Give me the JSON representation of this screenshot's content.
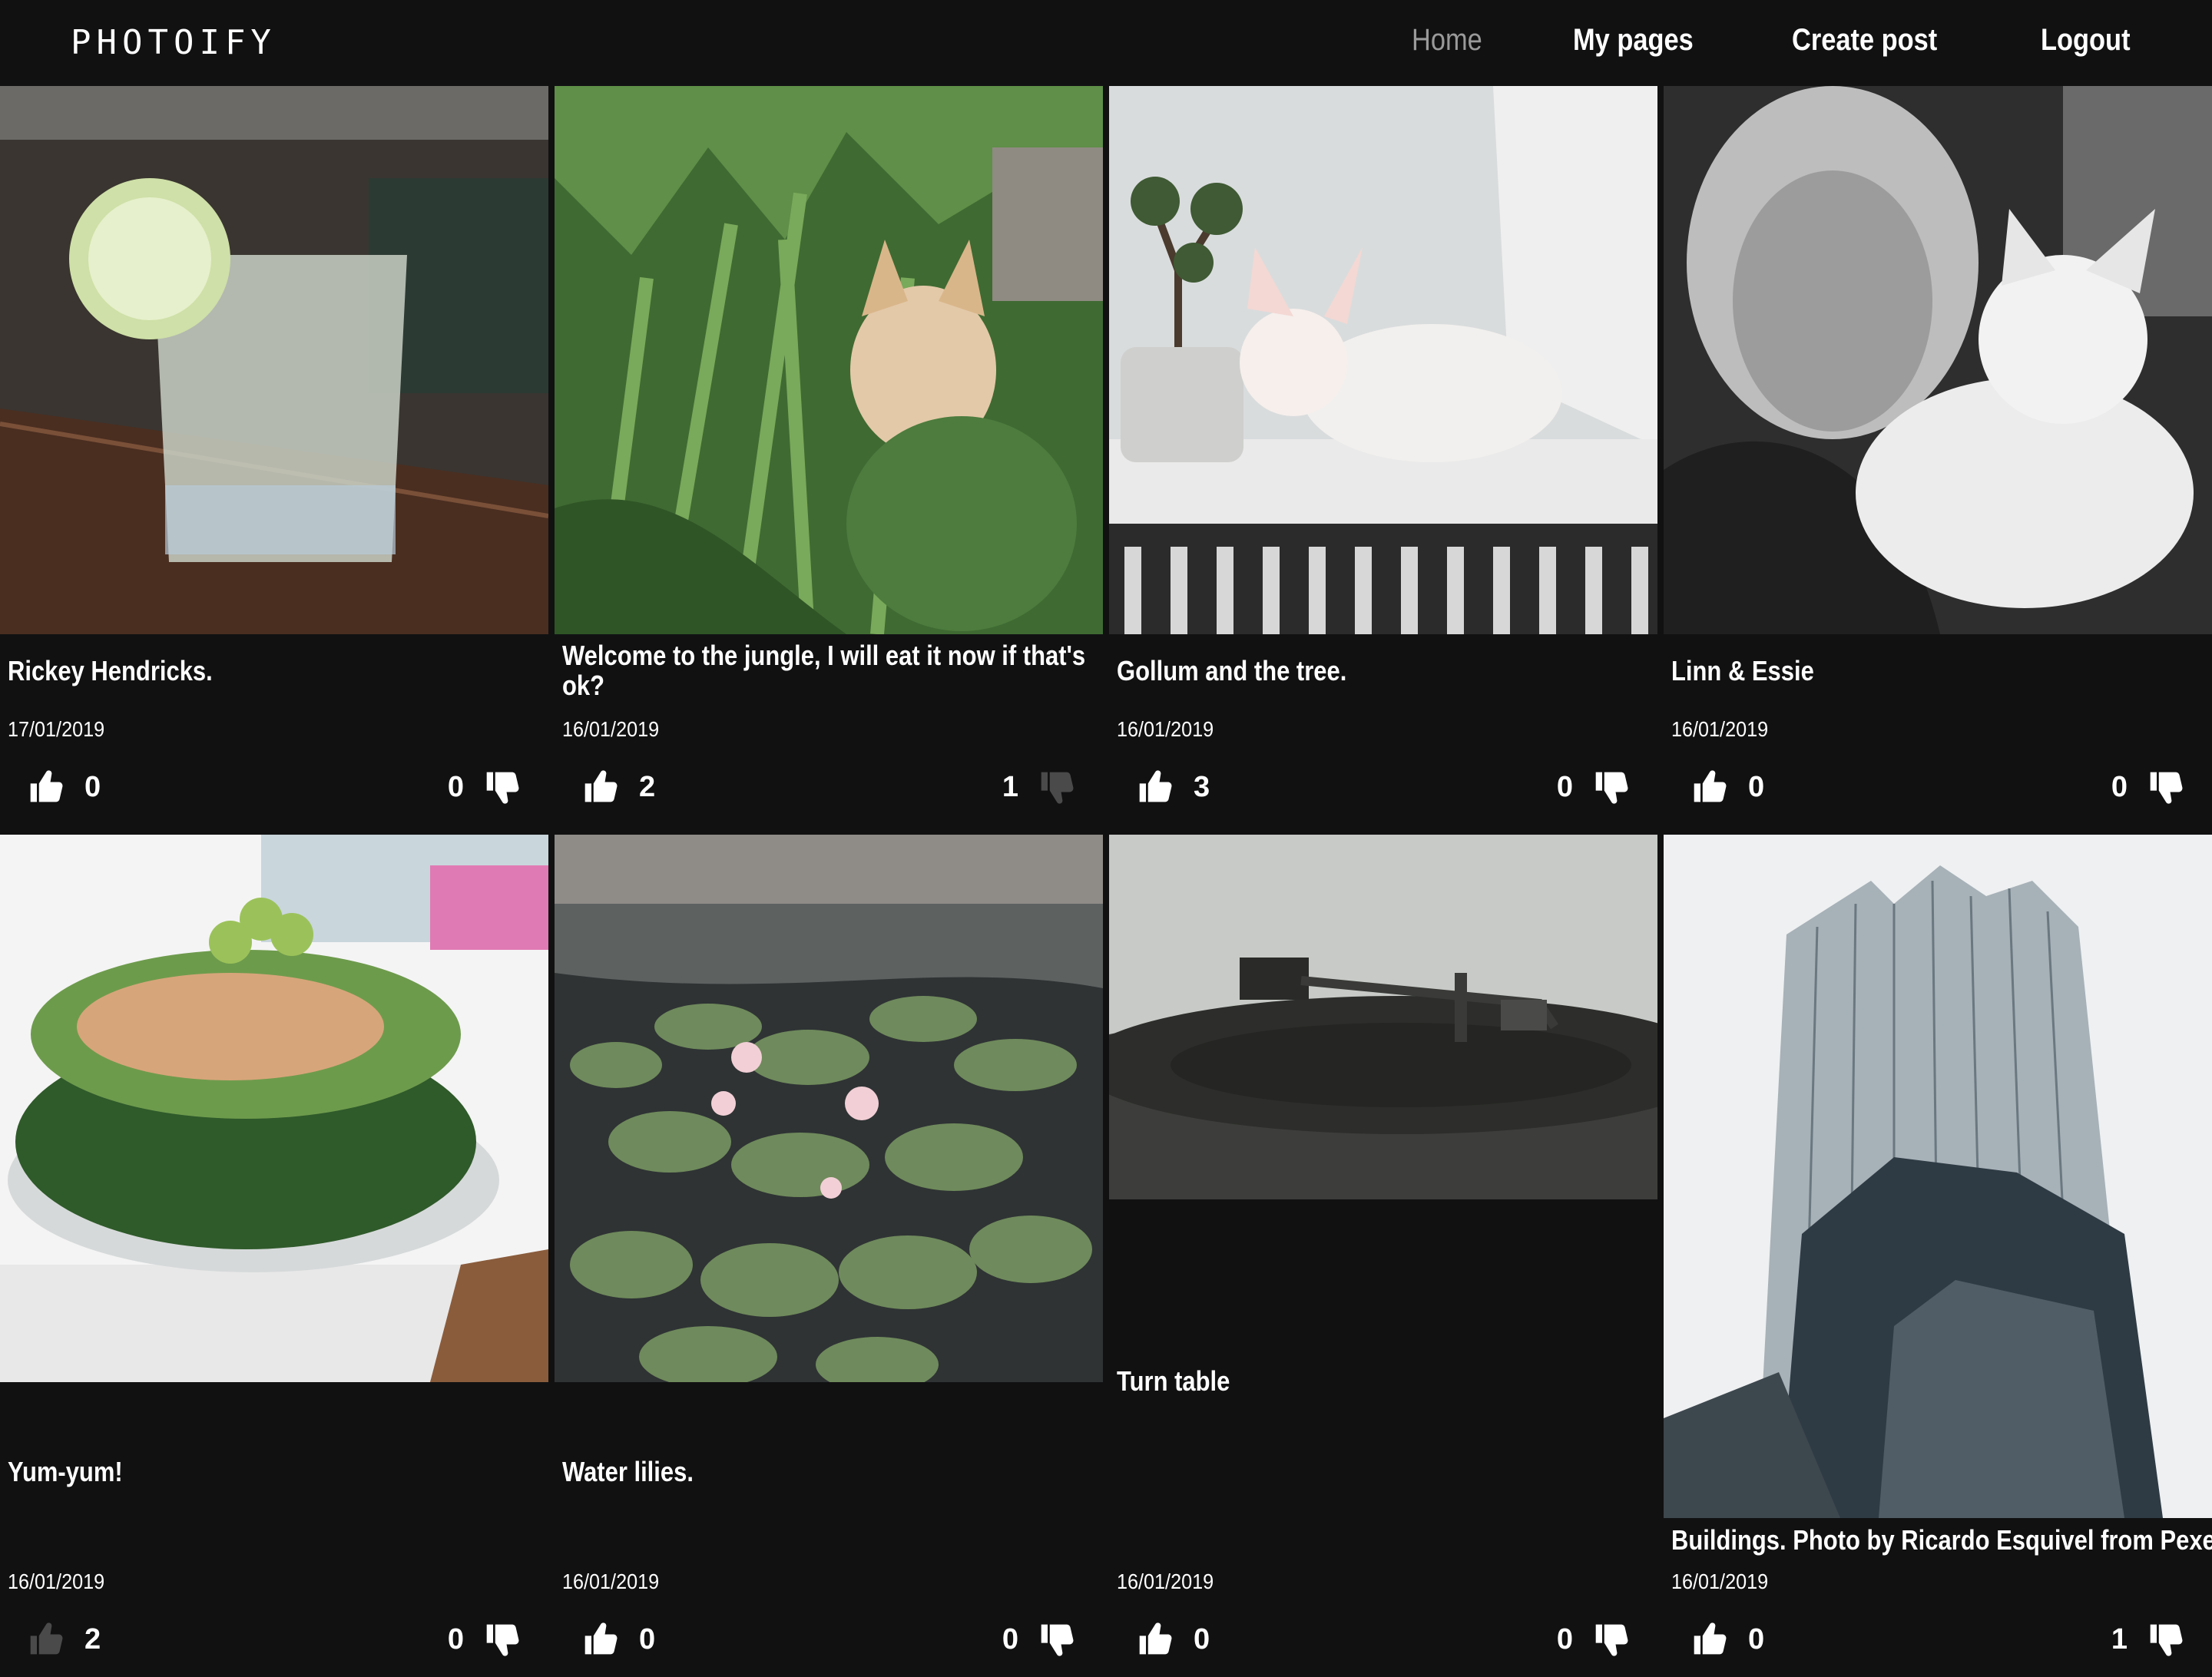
{
  "app": {
    "logo": "PHOTOIFY",
    "nav": {
      "home": "Home",
      "my_pages": "My pages",
      "create_post": "Create post",
      "logout": "Logout"
    }
  },
  "colors": {
    "background": "#111112",
    "text": "#ffffff",
    "nav_active": "#9a9a9a",
    "vote_disabled": "#4a4a4a"
  },
  "posts": [
    {
      "title": "Rickey Hendricks.",
      "date": "17/01/2019",
      "likes": "0",
      "dislikes": "0",
      "like_icon": "thumbs-up-icon",
      "dislike_icon": "thumbs-down-icon",
      "like_active": true,
      "dislike_active": true,
      "image": "cucumber drink in glass"
    },
    {
      "title": "Welcome to the jungle, I will eat it now if that's ok?",
      "date": "16/01/2019",
      "likes": "2",
      "dislikes": "1",
      "like_icon": "thumbs-up-icon",
      "dislike_icon": "thumbs-down-icon",
      "like_active": true,
      "dislike_active": false,
      "image": "cat in garden plants"
    },
    {
      "title": "Gollum and the tree.",
      "date": "16/01/2019",
      "likes": "3",
      "dislikes": "0",
      "like_icon": "thumbs-up-icon",
      "dislike_icon": "thumbs-down-icon",
      "like_active": true,
      "dislike_active": true,
      "image": "white cat next to bonsai"
    },
    {
      "title": "Linn & Essie",
      "date": "16/01/2019",
      "likes": "0",
      "dislikes": "0",
      "like_icon": "thumbs-up-icon",
      "dislike_icon": "thumbs-down-icon",
      "like_active": true,
      "dislike_active": true,
      "image": "woman with white cat"
    },
    {
      "title": "Yum-yum!",
      "date": "16/01/2019",
      "likes": "2",
      "dislikes": "0",
      "like_icon": "thumbs-up-icon",
      "dislike_icon": "thumbs-down-icon",
      "like_active": false,
      "dislike_active": true,
      "image": "sandwich cake"
    },
    {
      "title": "Water lilies.",
      "date": "16/01/2019",
      "likes": "0",
      "dislikes": "0",
      "like_icon": "thumbs-up-icon",
      "dislike_icon": "thumbs-down-icon",
      "like_active": true,
      "dislike_active": true,
      "image": "water lilies in pond"
    },
    {
      "title": "Turn table",
      "date": "16/01/2019",
      "likes": "0",
      "dislikes": "0",
      "like_icon": "thumbs-up-icon",
      "dislike_icon": "thumbs-down-icon",
      "like_active": true,
      "dislike_active": true,
      "image": "record turntable"
    },
    {
      "title": "Buildings. Photo by Ricardo Esquivel from Pexels.",
      "date": "16/01/2019",
      "likes": "0",
      "dislikes": "1",
      "like_icon": "thumbs-up-icon",
      "dislike_icon": "thumbs-down-icon",
      "like_active": true,
      "dislike_active": true,
      "image": "skyscrapers from below"
    }
  ]
}
